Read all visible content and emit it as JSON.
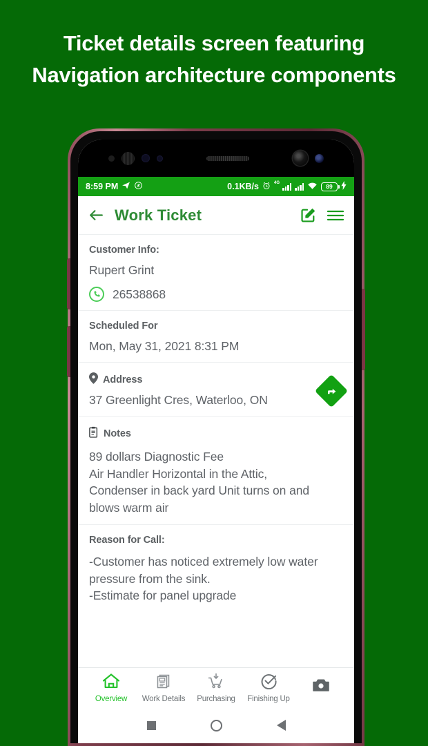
{
  "headline": {
    "line1": "Ticket details screen featuring",
    "line2": "Navigation architecture components"
  },
  "colors": {
    "background": "#056a06",
    "status_bar": "#14a014",
    "title_green": "#2e8b35",
    "accent_green": "#12a112",
    "active_tab": "#24c22b",
    "body_text": "#5f6368",
    "label_text": "#5b5f62"
  },
  "status_bar": {
    "time": "8:59 PM",
    "telegram_icon": "send-icon",
    "mute_icon": "mute-icon",
    "network_speed": "0.1KB/s",
    "alarm_icon": "alarm-icon",
    "network_type": "4G",
    "signal_icon": "signal-bars-icon",
    "signal_icon_2": "signal-bars-icon",
    "wifi_icon": "wifi-icon",
    "battery_level": "89",
    "charging_icon": "bolt-icon"
  },
  "appbar": {
    "back_icon": "arrow-left-icon",
    "title": "Work Ticket",
    "edit_icon": "edit-pencil-icon",
    "menu_icon": "hamburger-menu-icon"
  },
  "sections": {
    "customer": {
      "label": "Customer Info:",
      "name": "Rupert Grint",
      "phone_icon": "phone-icon",
      "phone": "26538868"
    },
    "scheduled": {
      "label": "Scheduled For",
      "value": "Mon, May 31, 2021  8:31 PM"
    },
    "address": {
      "pin_icon": "map-pin-icon",
      "label": "Address",
      "value": "37 Greenlight Cres, Waterloo, ON",
      "navigate_icon": "navigation-arrow-icon"
    },
    "notes": {
      "clipboard_icon": "clipboard-icon",
      "label": "Notes",
      "value": "89 dollars Diagnostic Fee\nAir Handler Horizontal in the Attic,\nCondenser in back yard Unit turns on and\nblows warm air"
    },
    "reason": {
      "label": "Reason for Call:",
      "value": "-Customer has noticed extremely low water\npressure from the sink.\n-Estimate for panel upgrade"
    }
  },
  "bottom_nav": {
    "items": [
      {
        "label": "Overview",
        "icon": "home-icon",
        "active": true
      },
      {
        "label": "Work Details",
        "icon": "documents-icon",
        "active": false
      },
      {
        "label": "Purchasing",
        "icon": "shopping-cart-icon",
        "active": false
      },
      {
        "label": "Finishing Up",
        "icon": "check-circle-icon",
        "active": false
      },
      {
        "label": "",
        "icon": "camera-icon",
        "active": false
      }
    ]
  },
  "android_nav": {
    "recents_icon": "square-recents-icon",
    "home_icon": "circle-home-icon",
    "back_icon": "triangle-back-icon"
  }
}
